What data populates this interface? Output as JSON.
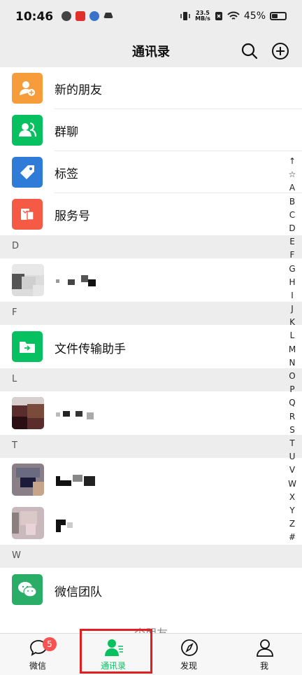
{
  "status": {
    "time": "10:46",
    "net_speed": "23.5",
    "net_unit": "MB/s",
    "battery": "45%"
  },
  "header": {
    "title": "通讯录"
  },
  "fixed_items": [
    {
      "label": "新的朋友",
      "icon": "add-friend-icon",
      "color": "#f79c3a"
    },
    {
      "label": "群聊",
      "icon": "group-chat-icon",
      "color": "#07c160"
    },
    {
      "label": "标签",
      "icon": "tag-icon",
      "color": "#2f7bd8"
    },
    {
      "label": "服务号",
      "icon": "service-account-icon",
      "color": "#f55a45"
    }
  ],
  "sections": [
    {
      "letter": "D"
    },
    {
      "letter": "F",
      "contact": "文件传输助手"
    },
    {
      "letter": "L"
    },
    {
      "letter": "T"
    },
    {
      "letter": "W",
      "contact": "微信团队"
    }
  ],
  "footer_partial": "个朋友",
  "index_letters": [
    "↑",
    "☆",
    "A",
    "B",
    "C",
    "D",
    "E",
    "F",
    "G",
    "H",
    "I",
    "J",
    "K",
    "L",
    "M",
    "N",
    "O",
    "P",
    "Q",
    "R",
    "S",
    "T",
    "U",
    "V",
    "W",
    "X",
    "Y",
    "Z",
    "#"
  ],
  "tabs": [
    {
      "label": "微信",
      "badge": "5"
    },
    {
      "label": "通讯录"
    },
    {
      "label": "发现"
    },
    {
      "label": "我"
    }
  ],
  "colors": {
    "accent": "#07c160",
    "badge": "#fa5151",
    "highlight": "#e02020"
  }
}
